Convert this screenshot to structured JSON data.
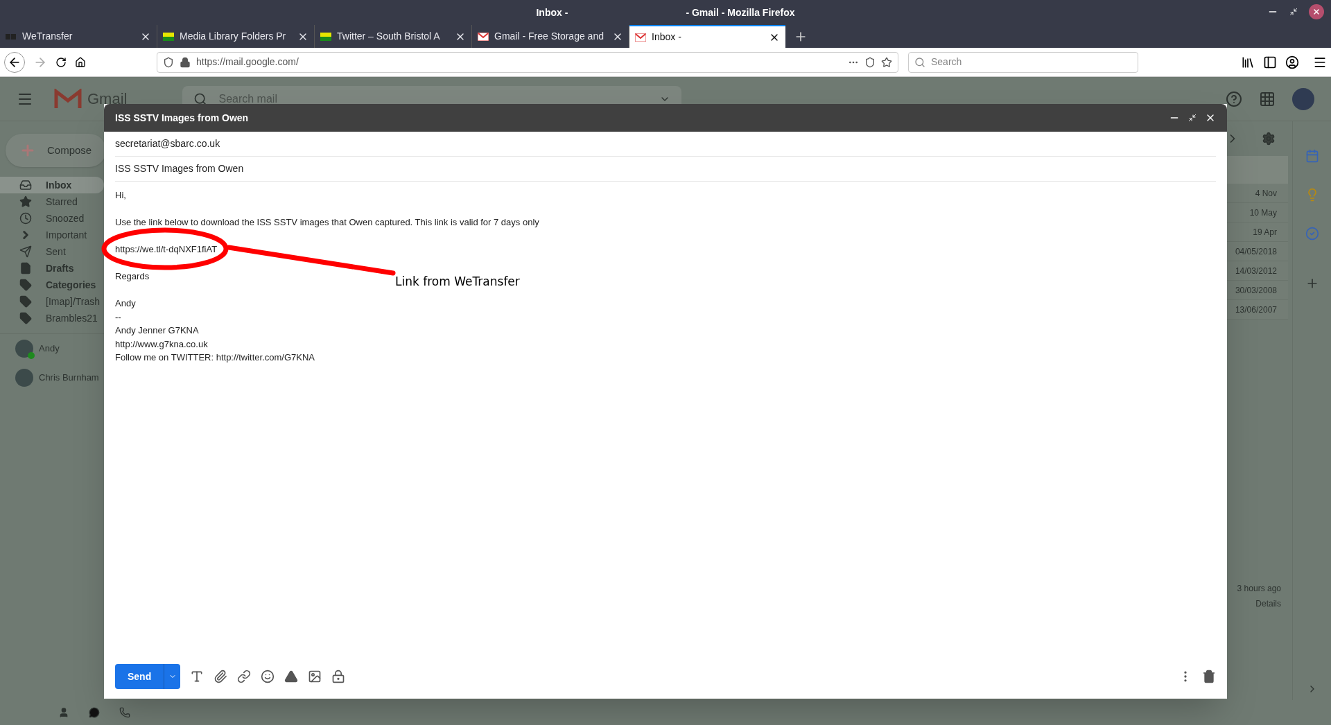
{
  "window": {
    "title_left": "Inbox -",
    "title_right": "- Gmail - Mozilla Firefox"
  },
  "tabs": [
    {
      "label": "WeTransfer",
      "selected": false
    },
    {
      "label": "Media Library Folders Pr",
      "selected": false
    },
    {
      "label": "Twitter – South Bristol A",
      "selected": false
    },
    {
      "label": "Gmail - Free Storage and",
      "selected": false
    },
    {
      "label": "Inbox -",
      "selected": true
    }
  ],
  "address_bar": {
    "url": "https://mail.google.com/"
  },
  "browser_search": {
    "placeholder": "Search"
  },
  "gmail": {
    "logo_text": "Gmail",
    "search_placeholder": "Search mail",
    "compose_label": "Compose",
    "sidebar": [
      {
        "label": "Inbox",
        "bold": true,
        "selected": true
      },
      {
        "label": "Starred",
        "bold": false,
        "selected": false
      },
      {
        "label": "Snoozed",
        "bold": false,
        "selected": false
      },
      {
        "label": "Important",
        "bold": false,
        "selected": false
      },
      {
        "label": "Sent",
        "bold": false,
        "selected": false
      },
      {
        "label": "Drafts",
        "bold": true,
        "selected": false
      },
      {
        "label": "Categories",
        "bold": true,
        "selected": false
      },
      {
        "label": "[Imap]/Trash",
        "bold": false,
        "selected": false
      },
      {
        "label": "Brambles21",
        "bold": false,
        "selected": false
      }
    ],
    "contacts": [
      {
        "name": "Andy",
        "online": true
      },
      {
        "name": "Chris Burnham",
        "online": false
      }
    ],
    "dates": [
      "4 Nov",
      "10 May",
      "19 Apr",
      "04/05/2018",
      "14/03/2012",
      "30/03/2008",
      "13/06/2007"
    ],
    "activity": "3 hours ago",
    "details": "Details"
  },
  "compose": {
    "title": "ISS SSTV Images from Owen",
    "to": "secretariat@sbarc.co.uk",
    "subject": "ISS SSTV Images from Owen",
    "body": [
      {
        "text": "Hi,",
        "kind": "line"
      },
      {
        "text": "Use the link below to download the ISS SSTV images that Owen captured. This link is valid for 7 days only",
        "kind": "line"
      },
      {
        "text": "https://we.tl/t-dqNXF1fiAT",
        "kind": "link"
      },
      {
        "text": "Regards",
        "kind": "line"
      },
      {
        "text": "Andy",
        "kind": "sig"
      },
      {
        "text": "--",
        "kind": "sig"
      },
      {
        "text": "Andy Jenner G7KNA",
        "kind": "sig"
      },
      {
        "text": "http://www.g7kna.co.uk",
        "kind": "sig"
      },
      {
        "text": "Follow me on TWITTER: http://twitter.com/G7KNA",
        "kind": "sig"
      }
    ],
    "send_label": "Send"
  },
  "annotation": {
    "text": "Link from WeTransfer"
  }
}
